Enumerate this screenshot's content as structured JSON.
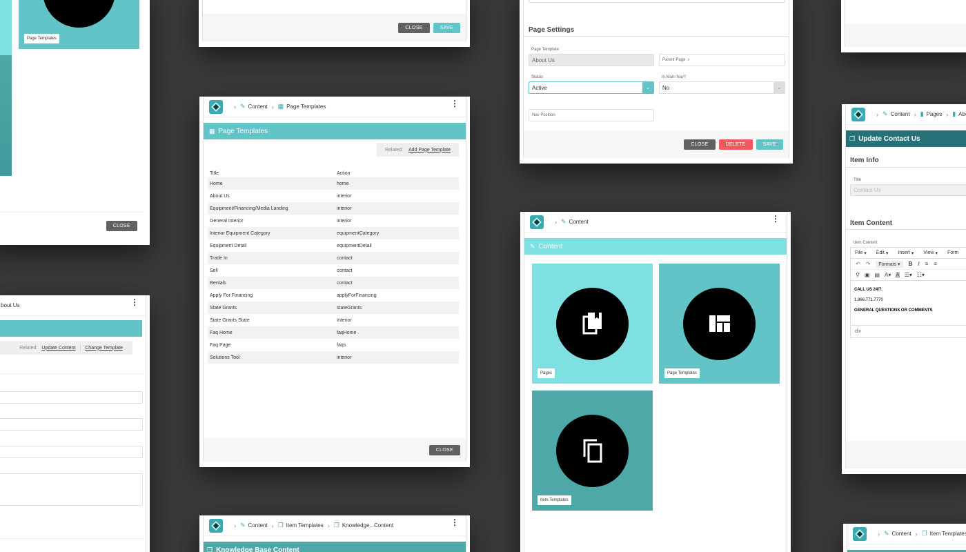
{
  "card1": {
    "tile_label": "Page Templates",
    "close": "CLOSE"
  },
  "card2": {
    "close": "CLOSE",
    "save": "SAVE"
  },
  "settings": {
    "section": "Page Settings",
    "template_label": "Page Template",
    "template_value": "About Us",
    "parent_placeholder": "Parent Page",
    "status_label": "Status",
    "status_value": "Active",
    "nav_label": "In Main Nav?",
    "nav_value": "No",
    "navpos_placeholder": "Nav Position",
    "close": "CLOSE",
    "delete": "DELETE",
    "save": "SAVE"
  },
  "right_top": {},
  "left_mid": {
    "crumb": "bout Us",
    "related": "Related:",
    "link1": "Update Content",
    "link2": "Change Template"
  },
  "templates": {
    "crumb1": "Content",
    "crumb2": "Page Templates",
    "title": "Page Templates",
    "related": "Related:",
    "add_link": "Add Page Template",
    "col_title": "Title",
    "col_action": "Action",
    "rows": [
      {
        "t": "Home",
        "a": "home"
      },
      {
        "t": "About Us",
        "a": "interior"
      },
      {
        "t": "Equipment/Financing/Media Landing",
        "a": "interior"
      },
      {
        "t": "General Interior",
        "a": "interior"
      },
      {
        "t": "Interior Equipment Category",
        "a": "equipmentCategory"
      },
      {
        "t": "Equipment Detail",
        "a": "equipmentDetail"
      },
      {
        "t": "Trade In",
        "a": "contact"
      },
      {
        "t": "Sell",
        "a": "contact"
      },
      {
        "t": "Rentals",
        "a": "contact"
      },
      {
        "t": "Apply For Financing",
        "a": "applyForFinancing"
      },
      {
        "t": "State Grants",
        "a": "stateGrants"
      },
      {
        "t": "State Grants State",
        "a": "Interior"
      },
      {
        "t": "Faq Home",
        "a": "faqHome"
      },
      {
        "t": "Faq Page",
        "a": "faqs"
      },
      {
        "t": "Solutions Tool",
        "a": "interior"
      }
    ],
    "close": "CLOSE"
  },
  "content": {
    "crumb": "Content",
    "title": "Content",
    "tile1": "Pages",
    "tile2": "Page Templates",
    "tile3": "Item Templates"
  },
  "contact": {
    "crumb1": "Content",
    "crumb2": "Pages",
    "crumb3": "About",
    "title": "Update Contact Us",
    "info": "Item Info",
    "title_label": "Title",
    "title_value": "Contact Us",
    "item_content": "Item Content",
    "ic_label": "Item Content",
    "menu": [
      "File",
      "Edit",
      "Insert",
      "View",
      "Form"
    ],
    "formats": "Formats",
    "line1": "CALL US 24/7.",
    "line2": "1.866.771.7770",
    "line3": "GENERAL QUESTIONS OR COMMENTS",
    "path": "div"
  },
  "kb": {
    "crumb1": "Content",
    "crumb2": "Item Templates",
    "crumb3": "Knowledge...Content",
    "title": "Knowledge Base Content"
  },
  "br": {
    "crumb1": "Content",
    "crumb2": "Item Templates"
  },
  "colors": {
    "teal": "#62c4c6",
    "teal_light": "#7ee0e0",
    "teal_dark": "#267177",
    "tile_dark": "#4fa8a8"
  }
}
